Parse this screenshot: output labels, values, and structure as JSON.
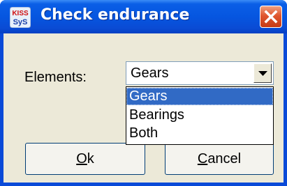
{
  "window": {
    "title": "Check endurance",
    "icon": "kisssoft-app-icon",
    "icon_text_top": "KISS",
    "icon_text_bottom": "SyS"
  },
  "form": {
    "elements_label": "Elements:",
    "selected_value": "Gears",
    "options": [
      "Gears",
      "Bearings",
      "Both"
    ],
    "highlighted_option": "Gears"
  },
  "buttons": {
    "ok_mnemonic": "O",
    "ok_rest": "k",
    "cancel_mnemonic": "C",
    "cancel_rest": "ancel"
  },
  "colors": {
    "titlebar": "#0656e0",
    "client": "#ece9d8",
    "selection": "#316ac5",
    "close": "#e0562e"
  }
}
